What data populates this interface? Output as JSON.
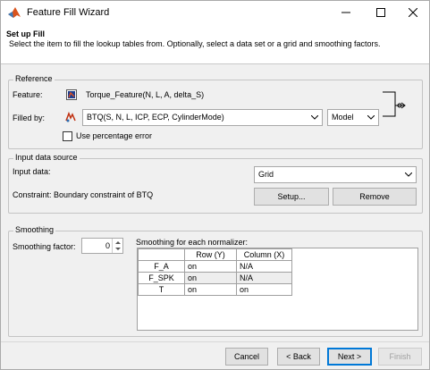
{
  "window": {
    "title": "Feature Fill Wizard",
    "controls": {
      "minimize_icon": "minimize-icon",
      "maximize_icon": "maximize-icon",
      "close_icon": "close-icon"
    }
  },
  "header": {
    "title": "Set up Fill",
    "description": "Select the item to fill the lookup tables from. Optionally, select a data set or a grid and smoothing factors."
  },
  "reference": {
    "group_title": "Reference",
    "feature_label": "Feature:",
    "feature_value": "Torque_Feature(N, L, A, delta_S)",
    "filled_by_label": "Filled by:",
    "filled_by_value": "BTQ(S, N, L, ICP, ECP, CylinderMode)",
    "type_value": "Model",
    "percentage_error_label": "Use percentage error",
    "percentage_error_checked": false
  },
  "input_source": {
    "group_title": "Input data source",
    "input_data_label": "Input data:",
    "input_data_value": "Grid",
    "constraint_text": "Constraint: Boundary constraint of BTQ",
    "setup_label": "Setup...",
    "remove_label": "Remove"
  },
  "smoothing": {
    "group_title": "Smoothing",
    "factor_label": "Smoothing factor:",
    "factor_value": "0",
    "normalizer_label": "Smoothing for each normalizer:",
    "columns": [
      "",
      "Row (Y)",
      "Column (X)"
    ],
    "rows": [
      {
        "name": "F_A",
        "row": "on",
        "col": "N/A"
      },
      {
        "name": "F_SPK",
        "row": "on",
        "col": "N/A"
      },
      {
        "name": "T",
        "row": "on",
        "col": "on"
      }
    ]
  },
  "footer": {
    "cancel": "Cancel",
    "back": "< Back",
    "next": "Next >",
    "finish": "Finish"
  },
  "colors": {
    "accent": "#0078d7",
    "group_border": "#c4c4c4",
    "panel": "#f0f0f0"
  }
}
